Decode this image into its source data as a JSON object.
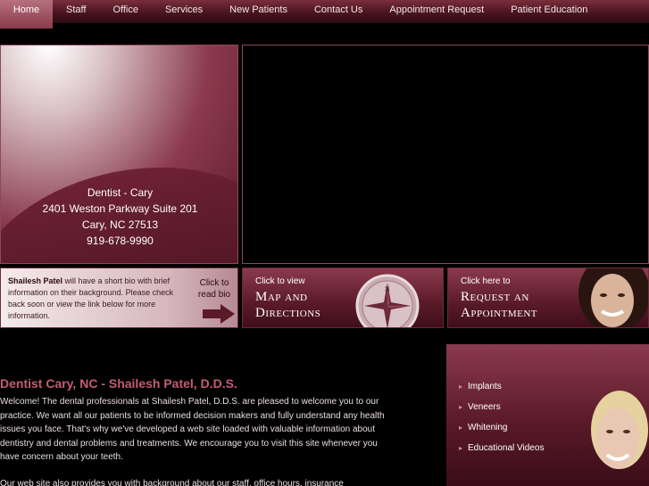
{
  "nav": {
    "items": [
      {
        "label": "Home",
        "active": true
      },
      {
        "label": "Staff"
      },
      {
        "label": "Office"
      },
      {
        "label": "Services"
      },
      {
        "label": "New Patients"
      },
      {
        "label": "Contact Us"
      },
      {
        "label": "Appointment Request"
      },
      {
        "label": "Patient Education"
      }
    ]
  },
  "hero": {
    "line1": "Dentist - Cary",
    "line2": "2401 Weston Parkway Suite 201",
    "line3": "Cary, NC 27513",
    "phone": "919-678-9990"
  },
  "bio": {
    "name": "Shailesh Patel",
    "text": " will have a short bio with brief information on their background. Please check back soon or view the link below for more information.",
    "cta": "Click to read bio"
  },
  "map_promo": {
    "small": "Click to view",
    "big1": "Map and",
    "big2": "Directions"
  },
  "appt_promo": {
    "small": "Click here to",
    "big1": "Request an",
    "big2": "Appointment"
  },
  "content": {
    "heading": "Dentist Cary, NC - Shailesh Patel, D.D.S.",
    "para1": "Welcome! The dental professionals at Shailesh Patel, D.D.S. are pleased to welcome you to our practice. We want all our patients to be informed decision makers and fully understand any health issues you face. That's why we've developed a web site loaded with valuable information about dentistry and dental problems and treatments. We encourage you to visit this site whenever you have concern about your teeth.",
    "para2": "Our web site also provides you with background about our staff, office hours, insurance"
  },
  "sidebar": {
    "items": [
      {
        "label": "Implants"
      },
      {
        "label": "Veneers"
      },
      {
        "label": "Whitening"
      },
      {
        "label": "Educational Videos"
      }
    ]
  },
  "colors": {
    "accent": "#c45b74",
    "brand_dark": "#4a1420",
    "brand_mid": "#8a3a4c"
  }
}
